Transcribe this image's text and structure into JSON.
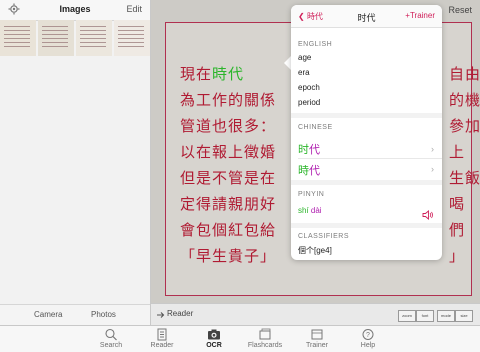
{
  "sidebar": {
    "title": "Images",
    "edit_label": "Edit",
    "camera_label": "Camera",
    "photos_label": "Photos"
  },
  "main": {
    "reset_label": "Reset",
    "reader_label": "Reader",
    "mini_buttons": [
      "zoom",
      "font",
      "mode",
      "size"
    ]
  },
  "document": {
    "lines": [
      {
        "before": "現在",
        "highlight": "時代",
        "after": ""
      },
      {
        "before": "為工作的關係",
        "highlight": "",
        "after": ""
      },
      {
        "before": "管道也很多：",
        "highlight": "",
        "after": ""
      },
      {
        "before": "以在報上徵婚",
        "highlight": "",
        "after": ""
      },
      {
        "before": "但是不管是在",
        "highlight": "",
        "after": ""
      },
      {
        "before": "定得請親朋好",
        "highlight": "",
        "after": ""
      },
      {
        "before": "會包個紅包給",
        "highlight": "",
        "after": ""
      },
      {
        "before": "「早生貴子」",
        "highlight": "",
        "after": ""
      }
    ],
    "right_column": [
      "自由",
      "的機",
      "參加",
      "上",
      "生飯",
      "喝",
      "們",
      "」"
    ]
  },
  "popover": {
    "back_label": "時代",
    "title": "时代",
    "trainer_label": "+Trainer",
    "english_header": "ENGLISH",
    "english": [
      "age",
      "era",
      "epoch",
      "period"
    ],
    "chinese_header": "CHINESE",
    "chinese": [
      {
        "a": "时",
        "b": "代"
      },
      {
        "a": "時",
        "b": "代"
      }
    ],
    "pinyin_header": "PINYIN",
    "pinyin_a": "shí",
    "pinyin_b": "dài",
    "classifiers_header": "CLASSIFIERS",
    "classifier": "個个[ge4]"
  },
  "tabs": [
    {
      "label": "Search",
      "icon": "search-icon",
      "active": false
    },
    {
      "label": "Reader",
      "icon": "reader-icon",
      "active": false
    },
    {
      "label": "OCR",
      "icon": "camera-icon",
      "active": true
    },
    {
      "label": "Flashcards",
      "icon": "flashcards-icon",
      "active": false
    },
    {
      "label": "Trainer",
      "icon": "trainer-icon",
      "active": false
    },
    {
      "label": "Help",
      "icon": "help-icon",
      "active": false
    }
  ],
  "colors": {
    "accent": "#d0205a",
    "text_red": "#b01b33",
    "highlight": "#2bb52b",
    "pinyin_shi": "#2bb52b",
    "pinyin_dai": "#b020b0"
  }
}
